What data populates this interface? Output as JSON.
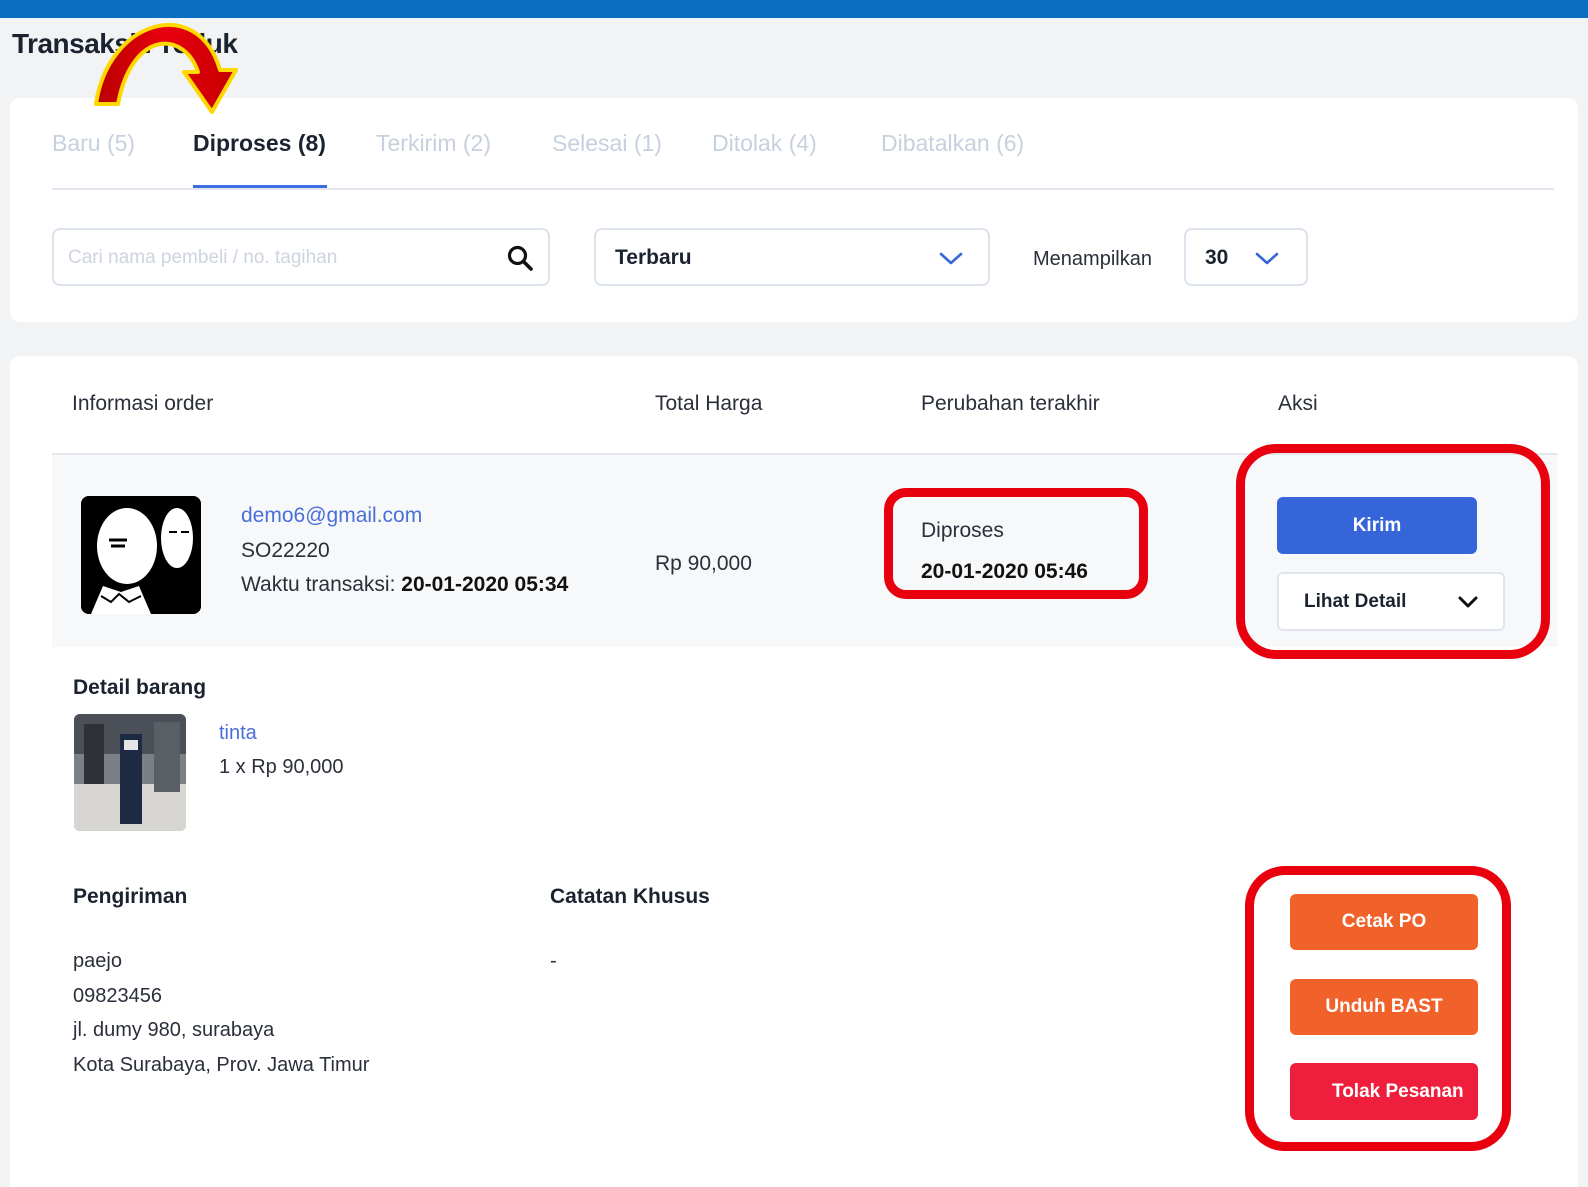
{
  "page": {
    "title": "Transaksi Produk"
  },
  "tabs": [
    {
      "label": "Baru (5)"
    },
    {
      "label": "Diproses (8)"
    },
    {
      "label": "Terkirim (2)"
    },
    {
      "label": "Selesai (1)"
    },
    {
      "label": "Ditolak (4)"
    },
    {
      "label": "Dibatalkan (6)"
    }
  ],
  "active_tab": "Diproses (8)",
  "filters": {
    "search_placeholder": "Cari nama pembeli / no. tagihan",
    "sort_value": "Terbaru",
    "show_label": "Menampilkan",
    "limit_value": "30"
  },
  "table": {
    "headers": [
      "Informasi order",
      "Total Harga",
      "Perubahan terakhir",
      "Aksi"
    ]
  },
  "order": {
    "email": "demo6@gmail.com",
    "so_number": "SO22220",
    "time_label": "Waktu transaksi: ",
    "time_value": "20-01-2020 05:34",
    "total": "Rp 90,000",
    "status": "Diproses",
    "status_date": "20-01-2020 05:46",
    "actions": {
      "send": "Kirim",
      "detail": "Lihat Detail"
    }
  },
  "items": {
    "title": "Detail barang",
    "list": [
      {
        "name": "tinta",
        "qty": "1 x Rp 90,000"
      }
    ]
  },
  "shipping": {
    "title": "Pengiriman",
    "lines": [
      "paejo",
      "09823456",
      "jl. dumy 980, surabaya",
      "Kota Surabaya, Prov. Jawa Timur"
    ]
  },
  "notes": {
    "title": "Catatan Khusus",
    "value": "-"
  },
  "extra_actions": {
    "print_po": "Cetak PO",
    "download_bast": "Unduh BAST",
    "reject": "Tolak Pesanan"
  },
  "colors": {
    "topbar": "#0a6fc0",
    "primary": "#3565d8",
    "orange": "#f0622a",
    "danger": "#ee1e3c",
    "highlight": "#e8000e"
  }
}
